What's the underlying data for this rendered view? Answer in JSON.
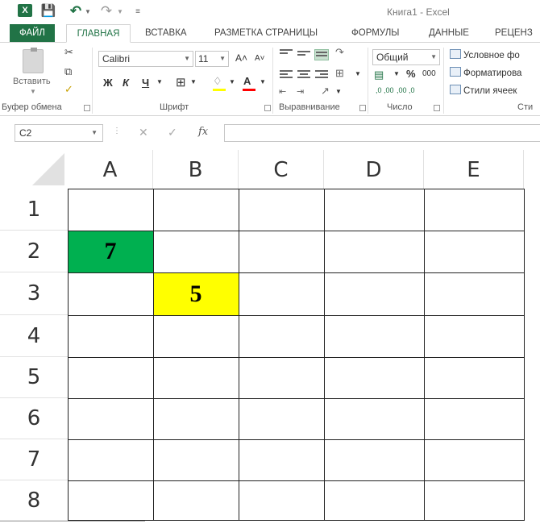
{
  "quick_access": {
    "excel_icon": "excel-logo-icon",
    "excel_label": "X",
    "save_icon": "save-icon",
    "undo_icon": "undo-icon",
    "redo_icon": "redo-icon"
  },
  "window": {
    "title": "Книга1 - Excel"
  },
  "tabs": [
    {
      "label": "ФАЙЛ"
    },
    {
      "label": "ГЛАВНАЯ"
    },
    {
      "label": "ВСТАВКА"
    },
    {
      "label": "РАЗМЕТКА СТРАНИЦЫ"
    },
    {
      "label": "ФОРМУЛЫ"
    },
    {
      "label": "ДАННЫЕ"
    },
    {
      "label": "РЕЦЕНЗ"
    }
  ],
  "ribbon": {
    "clipboard": {
      "paste_label": "Вставить",
      "group_label": "Буфер обмена"
    },
    "font": {
      "font_name": "Calibri",
      "font_size": "11",
      "bold": "Ж",
      "italic": "К",
      "underline": "Ч",
      "grow": "A˄",
      "shrink": "A˅",
      "font_color_label": "A",
      "group_label": "Шрифт"
    },
    "alignment": {
      "group_label": "Выравнивание"
    },
    "number": {
      "format": "Общий",
      "percent": "%",
      "thousands": "000",
      "inc_dec": ",0 ,00",
      "dec_dec": ",00 ,0",
      "group_label": "Число"
    },
    "styles": {
      "conditional": "Условное фо",
      "format_table": "Форматирова",
      "cell_styles": "Стили ячеек",
      "group_label": "Сти"
    }
  },
  "formula_bar": {
    "name_box": "C2",
    "fx": "fx",
    "formula": ""
  },
  "sheet": {
    "columns": [
      "A",
      "B",
      "C",
      "D",
      "E"
    ],
    "rows": [
      "1",
      "2",
      "3",
      "4",
      "5",
      "6",
      "7",
      "8"
    ],
    "cells": {
      "A2": "7",
      "B3": "5"
    },
    "colors": {
      "A2_fill": "#00b050",
      "B3_fill": "#ffff00",
      "accent": "#217346"
    }
  }
}
